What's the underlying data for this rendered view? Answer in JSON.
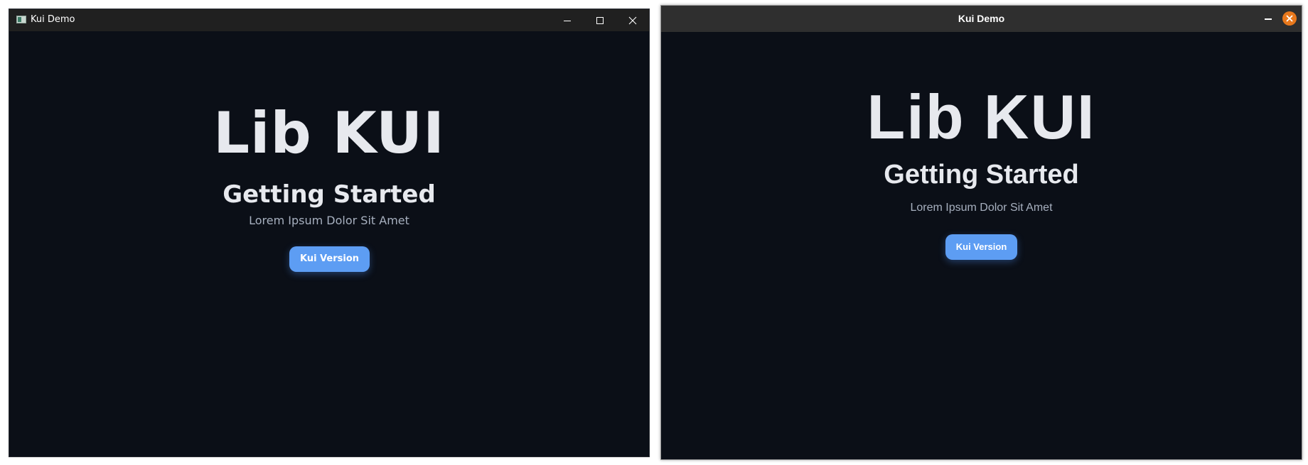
{
  "windows": [
    {
      "style": "windows",
      "title": "Kui Demo",
      "controls": [
        "minimize-icon",
        "maximize-icon",
        "close-icon"
      ],
      "content": {
        "hero": "Lib KUI",
        "subtitle": "Getting Started",
        "tagline": "Lorem Ipsum Dolor Sit Amet",
        "button": "Kui Version"
      }
    },
    {
      "style": "linux",
      "title": "Kui Demo",
      "controls": [
        "minimize-icon",
        "close-icon"
      ],
      "content": {
        "hero": "Lib KUI",
        "subtitle": "Getting Started",
        "tagline": "Lorem Ipsum Dolor Sit Amet",
        "button": "Kui Version"
      }
    }
  ],
  "colors": {
    "background": "#0b0f17",
    "text_primary": "#e7e9ee",
    "text_secondary": "#a7b0bf",
    "button": "#5d9df3",
    "close_accent": "#e8781c"
  }
}
